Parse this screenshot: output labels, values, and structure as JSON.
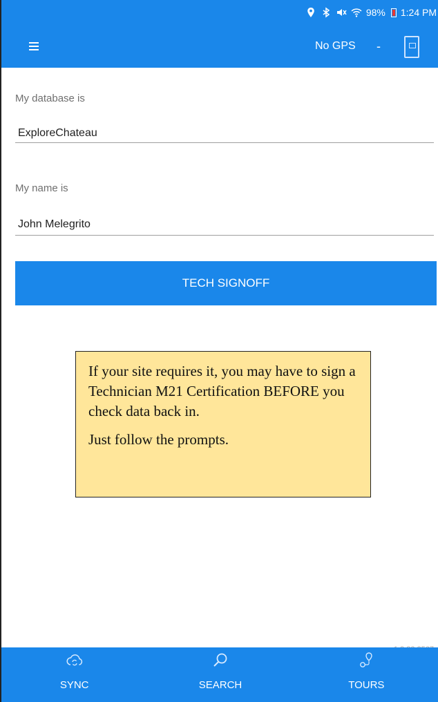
{
  "status_bar": {
    "battery_percent": "98%",
    "time": "1:24 PM",
    "icons": [
      "location-icon",
      "bluetooth-icon",
      "mute-icon",
      "wifi-icon",
      "battery-icon"
    ]
  },
  "app_bar": {
    "gps_status": "No GPS",
    "gps_separator": "-",
    "menu_icon": "hamburger-menu-icon",
    "doc_icon": "document-icon"
  },
  "form": {
    "database_label": "My database is",
    "database_value": "ExploreChateau",
    "name_label": "My name is",
    "name_value": "John Melegrito"
  },
  "signoff_button": {
    "label": "TECH SIGNOFF"
  },
  "note": {
    "paragraph1": "If your site requires it, you may have to sign a Technician M21 Certification BEFORE you check data back in.",
    "paragraph2": "Just follow the prompts."
  },
  "version": "1.2.82.2567",
  "bottom_nav": {
    "items": [
      {
        "label": "SYNC",
        "icon": "cloud-sync-icon"
      },
      {
        "label": "SEARCH",
        "icon": "search-icon"
      },
      {
        "label": "TOURS",
        "icon": "map-pin-route-icon"
      }
    ]
  },
  "colors": {
    "primary": "#1a87ea",
    "note_background": "#ffe69a",
    "battery_alert": "#e53935"
  }
}
